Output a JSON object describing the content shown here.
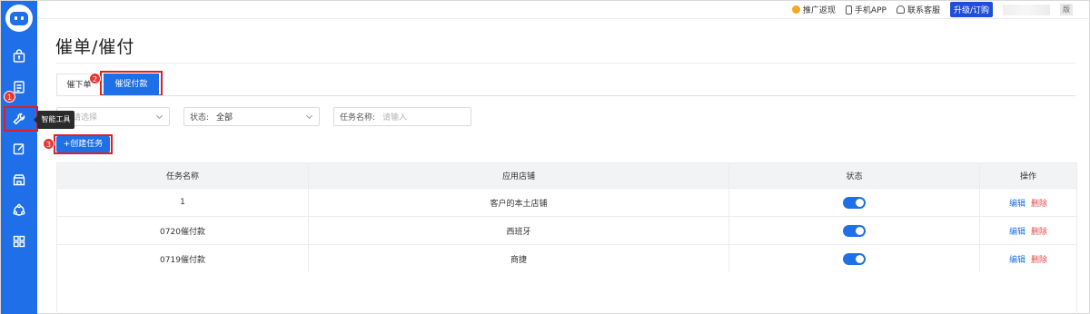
{
  "topbar": {
    "promo": "推广返现",
    "app": "手机APP",
    "service": "联系客服",
    "upgrade": "升级/订购",
    "version": "版"
  },
  "sidebar": {
    "tooltip": "智能工具",
    "badge1": "1"
  },
  "page": {
    "title": "催单/催付"
  },
  "tabs": [
    {
      "label": "催下单"
    },
    {
      "label": "催促付款",
      "badge": "2"
    }
  ],
  "filters": {
    "shop_label": ":",
    "shop_placeholder": "请选择",
    "status_label": "状态:",
    "status_value": "全部",
    "task_label": "任务名称:",
    "task_placeholder": "请输入"
  },
  "create_button": {
    "label": "+创建任务",
    "badge": "3"
  },
  "table": {
    "headers": [
      "任务名称",
      "应用店铺",
      "状态",
      "操作"
    ],
    "rows": [
      {
        "name": "1",
        "shop": "客户的本土店铺",
        "enabled": true
      },
      {
        "name": "0720催付款",
        "shop": "西班牙",
        "enabled": true
      },
      {
        "name": "0719催付款",
        "shop": "商捷",
        "enabled": true
      }
    ],
    "edit_label": "编辑",
    "delete_label": "删除"
  },
  "colors": {
    "primary": "#1f6fe8",
    "highlight": "#e02020",
    "danger": "#e54b4b"
  }
}
